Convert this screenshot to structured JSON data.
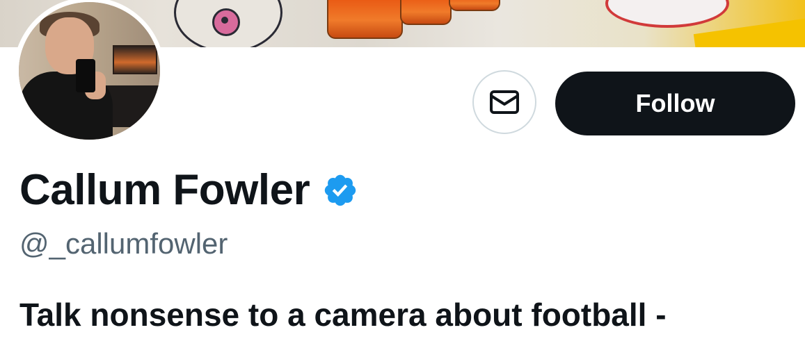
{
  "profile": {
    "display_name": "Callum Fowler",
    "handle": "@_callumfowler",
    "bio": "Talk nonsense to a camera about football -",
    "verified": true
  },
  "actions": {
    "message_icon": "envelope-icon",
    "follow_label": "Follow"
  },
  "colors": {
    "text_primary": "#0f1419",
    "text_secondary": "#536471",
    "verified_badge": "#1d9bf0",
    "follow_bg": "#0f1419",
    "border": "#cfd9de"
  }
}
